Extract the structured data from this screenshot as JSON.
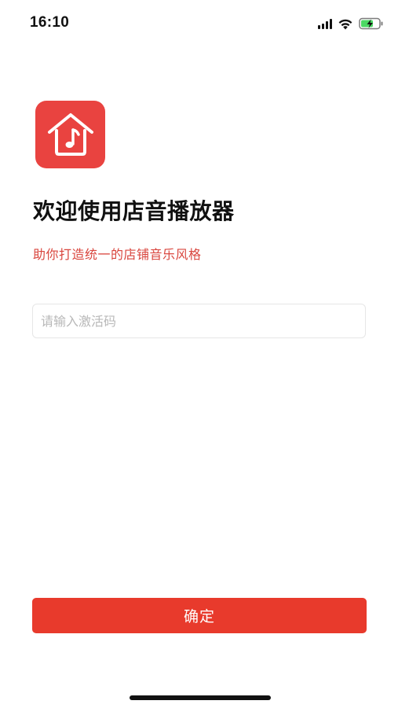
{
  "status_bar": {
    "time": "16:10",
    "icons": [
      "signal-icon",
      "wifi-icon",
      "battery-charging-icon"
    ]
  },
  "app": {
    "icon": "house-music-note-icon",
    "brand_color": "#e94340"
  },
  "welcome": {
    "title": "欢迎使用店音播放器",
    "subtitle": "助你打造统一的店铺音乐风格",
    "subtitle_color": "#d9463e"
  },
  "activation": {
    "placeholder": "请输入激活码",
    "value": ""
  },
  "confirm_button": {
    "label": "确定",
    "color": "#e83a2c"
  }
}
